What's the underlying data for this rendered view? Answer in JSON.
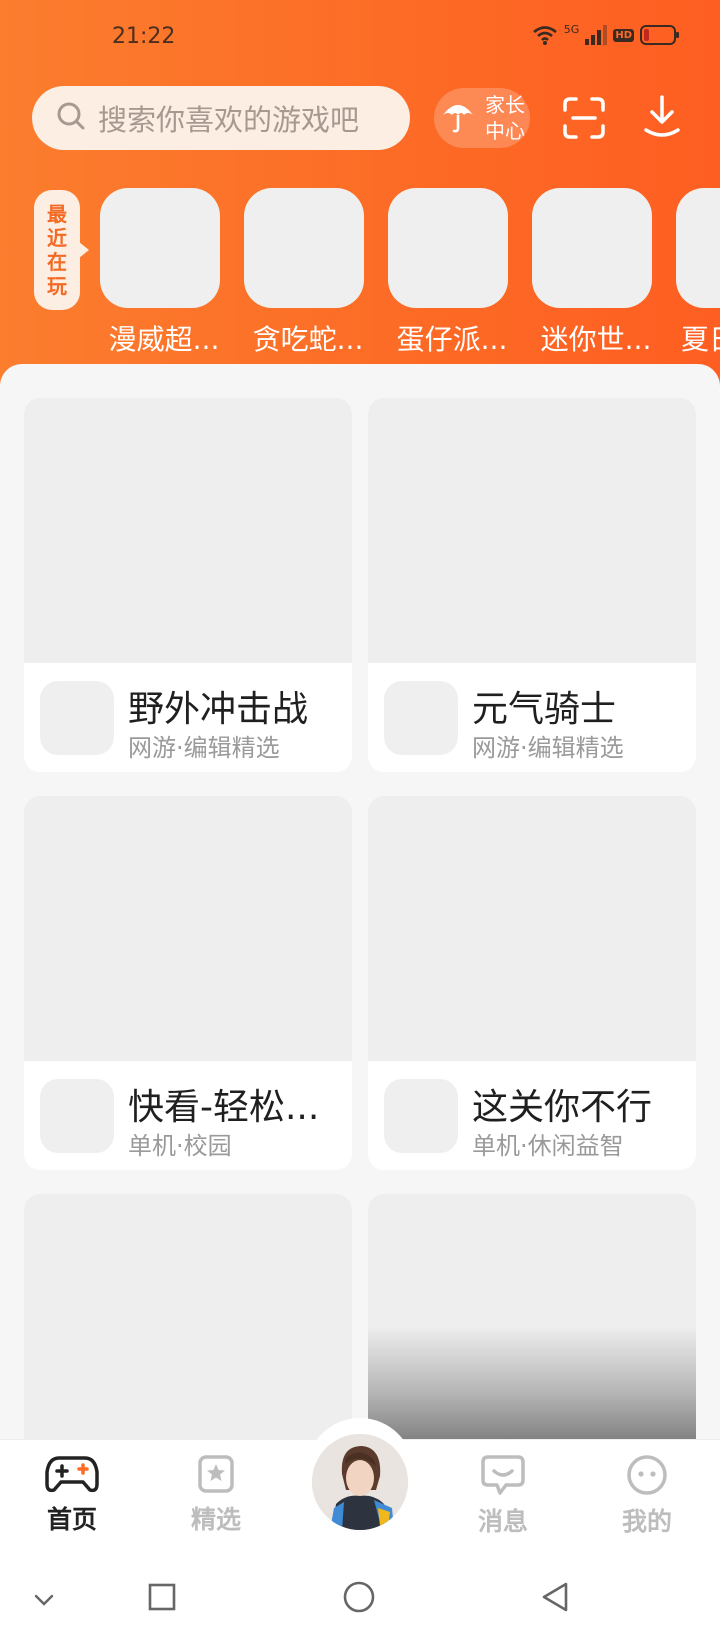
{
  "status_bar": {
    "time": "21:22",
    "network_label": "5G",
    "hd_label": "HD",
    "icons": [
      "wifi-icon",
      "signal-icon",
      "hd-icon",
      "battery-icon"
    ]
  },
  "header": {
    "search_placeholder": "搜索你喜欢的游戏吧",
    "parent_center_line1": "家长",
    "parent_center_line2": "中心"
  },
  "recent": {
    "tag_chars": [
      "最",
      "近",
      "在",
      "玩"
    ],
    "items": [
      {
        "name": "漫威超..."
      },
      {
        "name": "贪吃蛇..."
      },
      {
        "name": "蛋仔派..."
      },
      {
        "name": "迷你世..."
      },
      {
        "name": "夏日"
      }
    ]
  },
  "games": [
    {
      "title": "野外冲击战",
      "subtitle": "网游·编辑精选"
    },
    {
      "title": "元气骑士",
      "subtitle": "网游·编辑精选"
    },
    {
      "title": "快看-轻松...",
      "subtitle": "单机·校园"
    },
    {
      "title": "这关你不行",
      "subtitle": "单机·休闲益智"
    },
    {
      "title": "",
      "subtitle": ""
    },
    {
      "title": "",
      "subtitle": ""
    }
  ],
  "bottom_nav": {
    "home": "首页",
    "featured": "精选",
    "messages": "消息",
    "mine": "我的"
  },
  "colors": {
    "accent": "#fd6a25",
    "search_bg": "#fdeee4",
    "active_underline": "#ff6a26"
  }
}
